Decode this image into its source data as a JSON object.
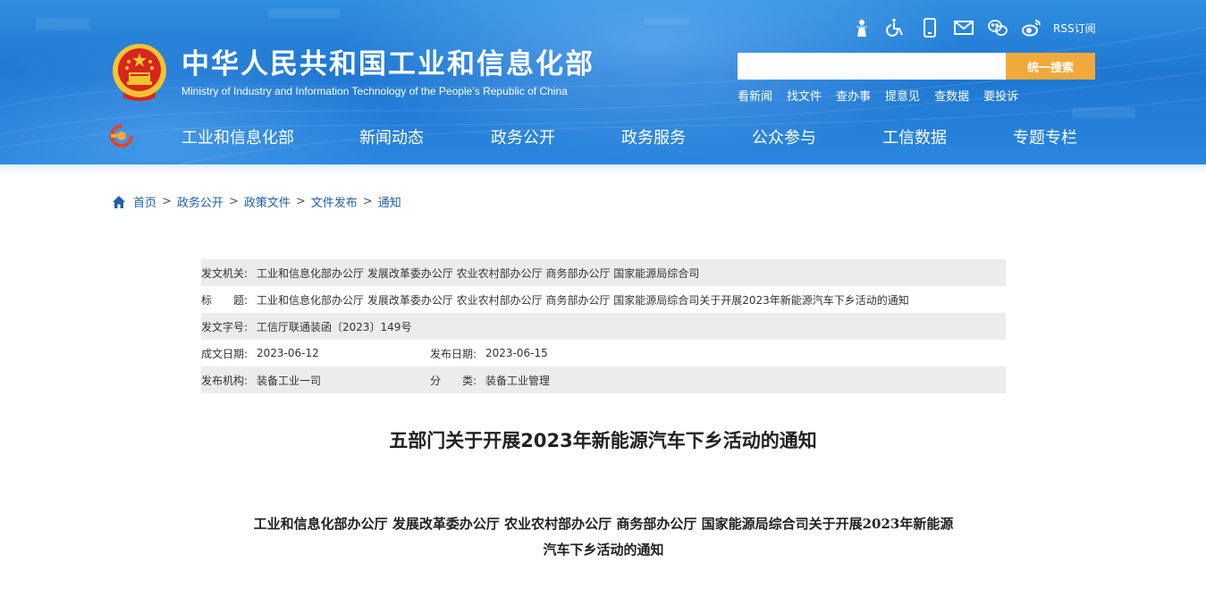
{
  "header": {
    "title": "中华人民共和国工业和信息化部",
    "subtitle": "Ministry of Industry and Information Technology of the People’s Republic of China",
    "toolbar_icons": [
      "elderly-mode-icon",
      "accessibility-icon",
      "mobile-icon",
      "mail-icon",
      "wechat-icon",
      "weibo-icon"
    ],
    "rss_label": "RSS订阅",
    "search": {
      "placeholder": "",
      "button_label": "统一搜索"
    },
    "quick_links": [
      "看新闻",
      "找文件",
      "查办事",
      "提意见",
      "查数据",
      "要投诉"
    ],
    "nav": [
      "工业和信息化部",
      "新闻动态",
      "政务公开",
      "政务服务",
      "公众参与",
      "工信数据",
      "专题专栏"
    ],
    "colors": {
      "banner": "#1f77d2",
      "search_button": "#f2a93b"
    }
  },
  "breadcrumb": [
    "首页",
    "政务公开",
    "政策文件",
    "文件发布",
    "通知"
  ],
  "info": {
    "issuer_label": "发文机关:",
    "issuer": "工业和信息化部办公厅 发展改革委办公厅 农业农村部办公厅 商务部办公厅 国家能源局综合司",
    "title_label": "标　　题:",
    "title": "工业和信息化部办公厅 发展改革委办公厅 农业农村部办公厅 商务部办公厅 国家能源局综合司关于开展2023年新能源汽车下乡活动的通知",
    "doc_no_label": "发文字号:",
    "doc_no": "工信厅联通装函〔2023〕149号",
    "created_label": "成文日期:",
    "created": "2023-06-12",
    "published_label": "发布日期:",
    "published": "2023-06-15",
    "org_label": "发布机构:",
    "org": "装备工业一司",
    "category_label": "分　　类:",
    "category": "装备工业管理"
  },
  "article": {
    "title": "五部门关于开展2023年新能源汽车下乡活动的通知",
    "doc_title_line1": "工业和信息化部办公厅  发展改革委办公厅  农业农村部办公厅  商务部办公厅  国家能源局综合司关于开展2023年新能源",
    "doc_title_line2": "汽车下乡活动的通知"
  }
}
